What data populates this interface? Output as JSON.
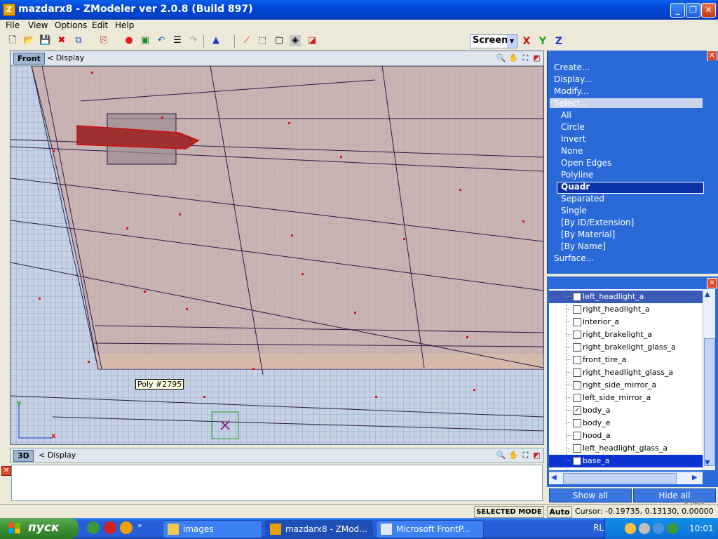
{
  "window": {
    "title": "mazdarx8 - ZModeler ver 2.0.8 (Build 897)",
    "app_icon_letter": "Z",
    "controls": [
      "minimize",
      "restore",
      "close"
    ]
  },
  "menubar": {
    "items": [
      "File",
      "View",
      "Options",
      "Edit",
      "Help"
    ]
  },
  "toolbar": {
    "icons": [
      "new-icon",
      "open-icon",
      "save-icon",
      "delete-icon",
      "copy-icon",
      "paste-icon",
      "render-icon",
      "import-icon",
      "undo-icon",
      "notes-icon",
      "redo-icon",
      "transform-icon",
      "vertex-mode-icon",
      "object-mode-icon",
      "box-mode-icon",
      "poly-mode-icon",
      "face-mode-icon"
    ],
    "coord_system": "Screen",
    "axis_x": "X",
    "axis_y": "Y",
    "axis_z": "Z",
    "colors": {
      "axis_x": "#d01010",
      "axis_y": "#20a020",
      "axis_z": "#1a3ad0"
    }
  },
  "viewport_front": {
    "name": "Front",
    "display_label": "< Display",
    "tooltip": "Poly #2795",
    "axis_y": "y",
    "axis_x": "x"
  },
  "viewport_3d": {
    "name": "3D",
    "display_label": "< Display"
  },
  "command_panel": {
    "create": "Create...",
    "display": "Display...",
    "modify": "Modify...",
    "select": "Select...",
    "select_options": [
      "All",
      "Circle",
      "Invert",
      "None",
      "Open Edges",
      "Polyline",
      "Quadr",
      "Separated",
      "Single",
      "[By ID/Extension]",
      "[By Material]",
      "[By Name]"
    ],
    "selected_option": "Quadr",
    "surface": "Surface..."
  },
  "object_tree": {
    "items": [
      {
        "label": "left_headlight_a",
        "checked": false,
        "highlight": "top"
      },
      {
        "label": "right_headlight_a",
        "checked": false
      },
      {
        "label": "interior_a",
        "checked": false
      },
      {
        "label": "right_brakelight_a",
        "checked": false
      },
      {
        "label": "right_brakelight_glass_a",
        "checked": false
      },
      {
        "label": "front_tire_a",
        "checked": false
      },
      {
        "label": "right_headlight_glass_a",
        "checked": false
      },
      {
        "label": "right_side_mirror_a",
        "checked": false
      },
      {
        "label": "left_side_mirror_a",
        "checked": false
      },
      {
        "label": "body_a",
        "checked": true
      },
      {
        "label": "body_e",
        "checked": false
      },
      {
        "label": "hood_a",
        "checked": false
      },
      {
        "label": "left_headlight_glass_a",
        "checked": false
      },
      {
        "label": "base_a",
        "checked": false,
        "highlight": "selected"
      }
    ],
    "show_all": "Show all",
    "hide_all": "Hide all"
  },
  "statusbar": {
    "mode": "SELECTED MODE",
    "auto": "Auto",
    "cursor": "Cursor: -0.19735, 0.13130, 0.00000",
    "net_speed": "5 KB/s"
  },
  "taskbar": {
    "start": "пуск",
    "tasks": [
      {
        "label": "images",
        "icon": "folder-icon",
        "active": false
      },
      {
        "label": "mazdarx8 - ZMod...",
        "icon": "zmodeler-icon",
        "active": true
      },
      {
        "label": "Microsoft FrontP...",
        "icon": "frontpage-icon",
        "active": false
      }
    ],
    "language": "RL",
    "clock": "10:01"
  }
}
